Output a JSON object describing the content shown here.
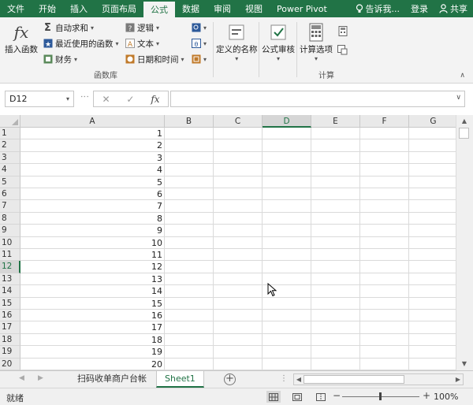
{
  "ribbon_tabs": [
    {
      "label": "文件",
      "active": false
    },
    {
      "label": "开始",
      "active": false
    },
    {
      "label": "插入",
      "active": false
    },
    {
      "label": "页面布局",
      "active": false
    },
    {
      "label": "公式",
      "active": true
    },
    {
      "label": "数据",
      "active": false
    },
    {
      "label": "审阅",
      "active": false
    },
    {
      "label": "视图",
      "active": false
    },
    {
      "label": "Power Pivot",
      "active": false
    }
  ],
  "tell_me": "告诉我...",
  "login": "登录",
  "share": "共享",
  "ribbon": {
    "function_library": {
      "label": "函数库",
      "insert_function": "插入函数",
      "insert_function_glyph": "fx",
      "autosum": "自动求和",
      "recent": "最近使用的函数",
      "financial": "财务",
      "logical": "逻辑",
      "text": "文本",
      "datetime": "日期和时间"
    },
    "defined_names": "定义的名称",
    "formula_auditing": "公式审核",
    "calculation": {
      "label": "计算",
      "options": "计算选项"
    }
  },
  "formula_bar": {
    "name_box": "D12",
    "fx": "fx",
    "content": ""
  },
  "columns": [
    "A",
    "B",
    "C",
    "D",
    "E",
    "F",
    "G"
  ],
  "selected_column": "D",
  "rows": [
    {
      "num": "1",
      "a": "1"
    },
    {
      "num": "2",
      "a": "2"
    },
    {
      "num": "3",
      "a": "3"
    },
    {
      "num": "4",
      "a": "4"
    },
    {
      "num": "5",
      "a": "5"
    },
    {
      "num": "6",
      "a": "6"
    },
    {
      "num": "7",
      "a": "7"
    },
    {
      "num": "8",
      "a": "8"
    },
    {
      "num": "9",
      "a": "9"
    },
    {
      "num": "10",
      "a": "10"
    },
    {
      "num": "11",
      "a": "11"
    },
    {
      "num": "12",
      "a": "12"
    },
    {
      "num": "13",
      "a": "13"
    },
    {
      "num": "14",
      "a": "14"
    },
    {
      "num": "15",
      "a": "15"
    },
    {
      "num": "16",
      "a": "16"
    },
    {
      "num": "17",
      "a": "17"
    },
    {
      "num": "18",
      "a": "18"
    },
    {
      "num": "19",
      "a": "19"
    },
    {
      "num": "20",
      "a": "20"
    }
  ],
  "selected_row": "12",
  "sheets": [
    {
      "label": "扫码收单商户台帐",
      "active": false
    },
    {
      "label": "Sheet1",
      "active": true
    }
  ],
  "status": "就绪",
  "zoom": "100%",
  "theme": {
    "accent": "#217346"
  }
}
